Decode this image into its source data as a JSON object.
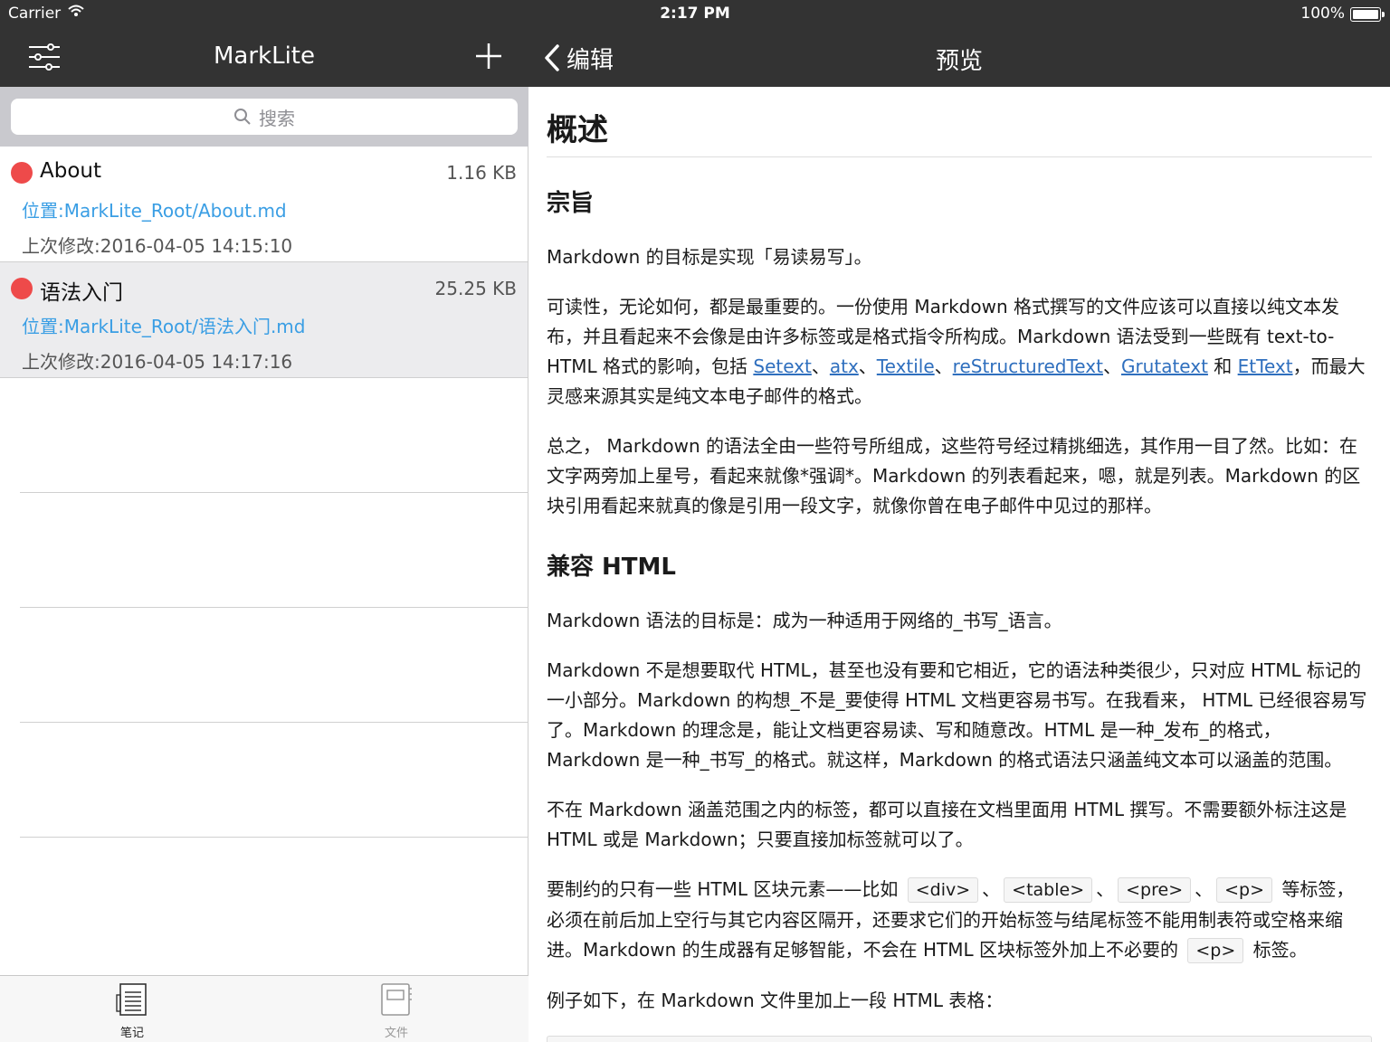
{
  "status_bar": {
    "carrier": "Carrier",
    "time": "2:17 PM",
    "battery": "100%"
  },
  "sidebar": {
    "title": "MarkLite",
    "search_placeholder": "搜索",
    "files": [
      {
        "name": "About",
        "size": "1.16 KB",
        "path": "位置:MarkLite_Root/About.md",
        "modified": "上次修改:2016-04-05 14:15:10",
        "dot_color": "#ee4a4a",
        "selected": false
      },
      {
        "name": "语法入门",
        "size": "25.25 KB",
        "path": "位置:MarkLite_Root/语法入门.md",
        "modified": "上次修改:2016-04-05 14:17:16",
        "dot_color": "#ee4a4a",
        "selected": true
      }
    ],
    "tabs": [
      {
        "label": "笔记",
        "icon": "notes-icon",
        "active": true
      },
      {
        "label": "文件",
        "icon": "folder-icon",
        "active": false
      }
    ]
  },
  "detail": {
    "back_label": "编辑",
    "title": "预览"
  },
  "preview": {
    "h1": "概述",
    "h2_purpose": "宗旨",
    "p1": "Markdown 的目标是实现「易读易写」。",
    "p2_a": "可读性，无论如何，都是最重要的。一份使用 Markdown 格式撰写的文件应该可以直接以纯文本发布，并且看起来不会像是由许多标签或是格式指令所构成。Markdown 语法受到一些既有 text-to-HTML 格式的影响，包括 ",
    "link_setext": "Setext",
    "sep1": "、",
    "link_atx": "atx",
    "sep2": "、",
    "link_textile": "Textile",
    "sep3": "、",
    "link_rst": "reStructuredText",
    "sep4": "、",
    "link_grutatext": "Grutatext",
    "and": " 和 ",
    "link_ettext": "EtText",
    "p2_b": "，而最大灵感来源其实是纯文本电子邮件的格式。",
    "p3": "总之， Markdown 的语法全由一些符号所组成，这些符号经过精挑细选，其作用一目了然。比如：在文字两旁加上星号，看起来就像*强调*。Markdown 的列表看起来，嗯，就是列表。Markdown 的区块引用看起来就真的像是引用一段文字，就像你曾在电子邮件中见过的那样。",
    "h2_html": "兼容 HTML",
    "p4": "Markdown 语法的目标是：成为一种适用于网络的_书写_语言。",
    "p5": "Markdown 不是想要取代 HTML，甚至也没有要和它相近，它的语法种类很少，只对应 HTML 标记的一小部分。Markdown 的构想_不是_要使得 HTML 文档更容易书写。在我看来， HTML 已经很容易写了。Markdown 的理念是，能让文档更容易读、写和随意改。HTML 是一种_发布_的格式，Markdown 是一种_书写_的格式。就这样，Markdown 的格式语法只涵盖纯文本可以涵盖的范围。",
    "p6": "不在 Markdown 涵盖范围之内的标签，都可以直接在文档里面用 HTML 撰写。不需要额外标注这是 HTML 或是 Markdown；只要直接加标签就可以了。",
    "p7_a": "要制约的只有一些 HTML 区块元素——比如 ",
    "code_div": "<div>",
    "p7_sep1": "、",
    "code_table": "<table>",
    "p7_sep2": "、",
    "code_pre": "<pre>",
    "p7_sep3": "、",
    "code_p1": "<p>",
    "p7_b": " 等标签，必须在前后加上空行与其它内容区隔开，还要求它们的开始标签与结尾标签不能用制表符或空格来缩进。Markdown 的生成器有足够智能，不会在 HTML 区块标签外加上不必要的 ",
    "code_p2": "<p>",
    "p7_c": " 标签。",
    "p8": "例子如下，在 Markdown 文件里加上一段 HTML 表格："
  },
  "colors": {
    "bar": "#333333",
    "link": "#3a9ee4",
    "dot": "#ee4a4a"
  }
}
